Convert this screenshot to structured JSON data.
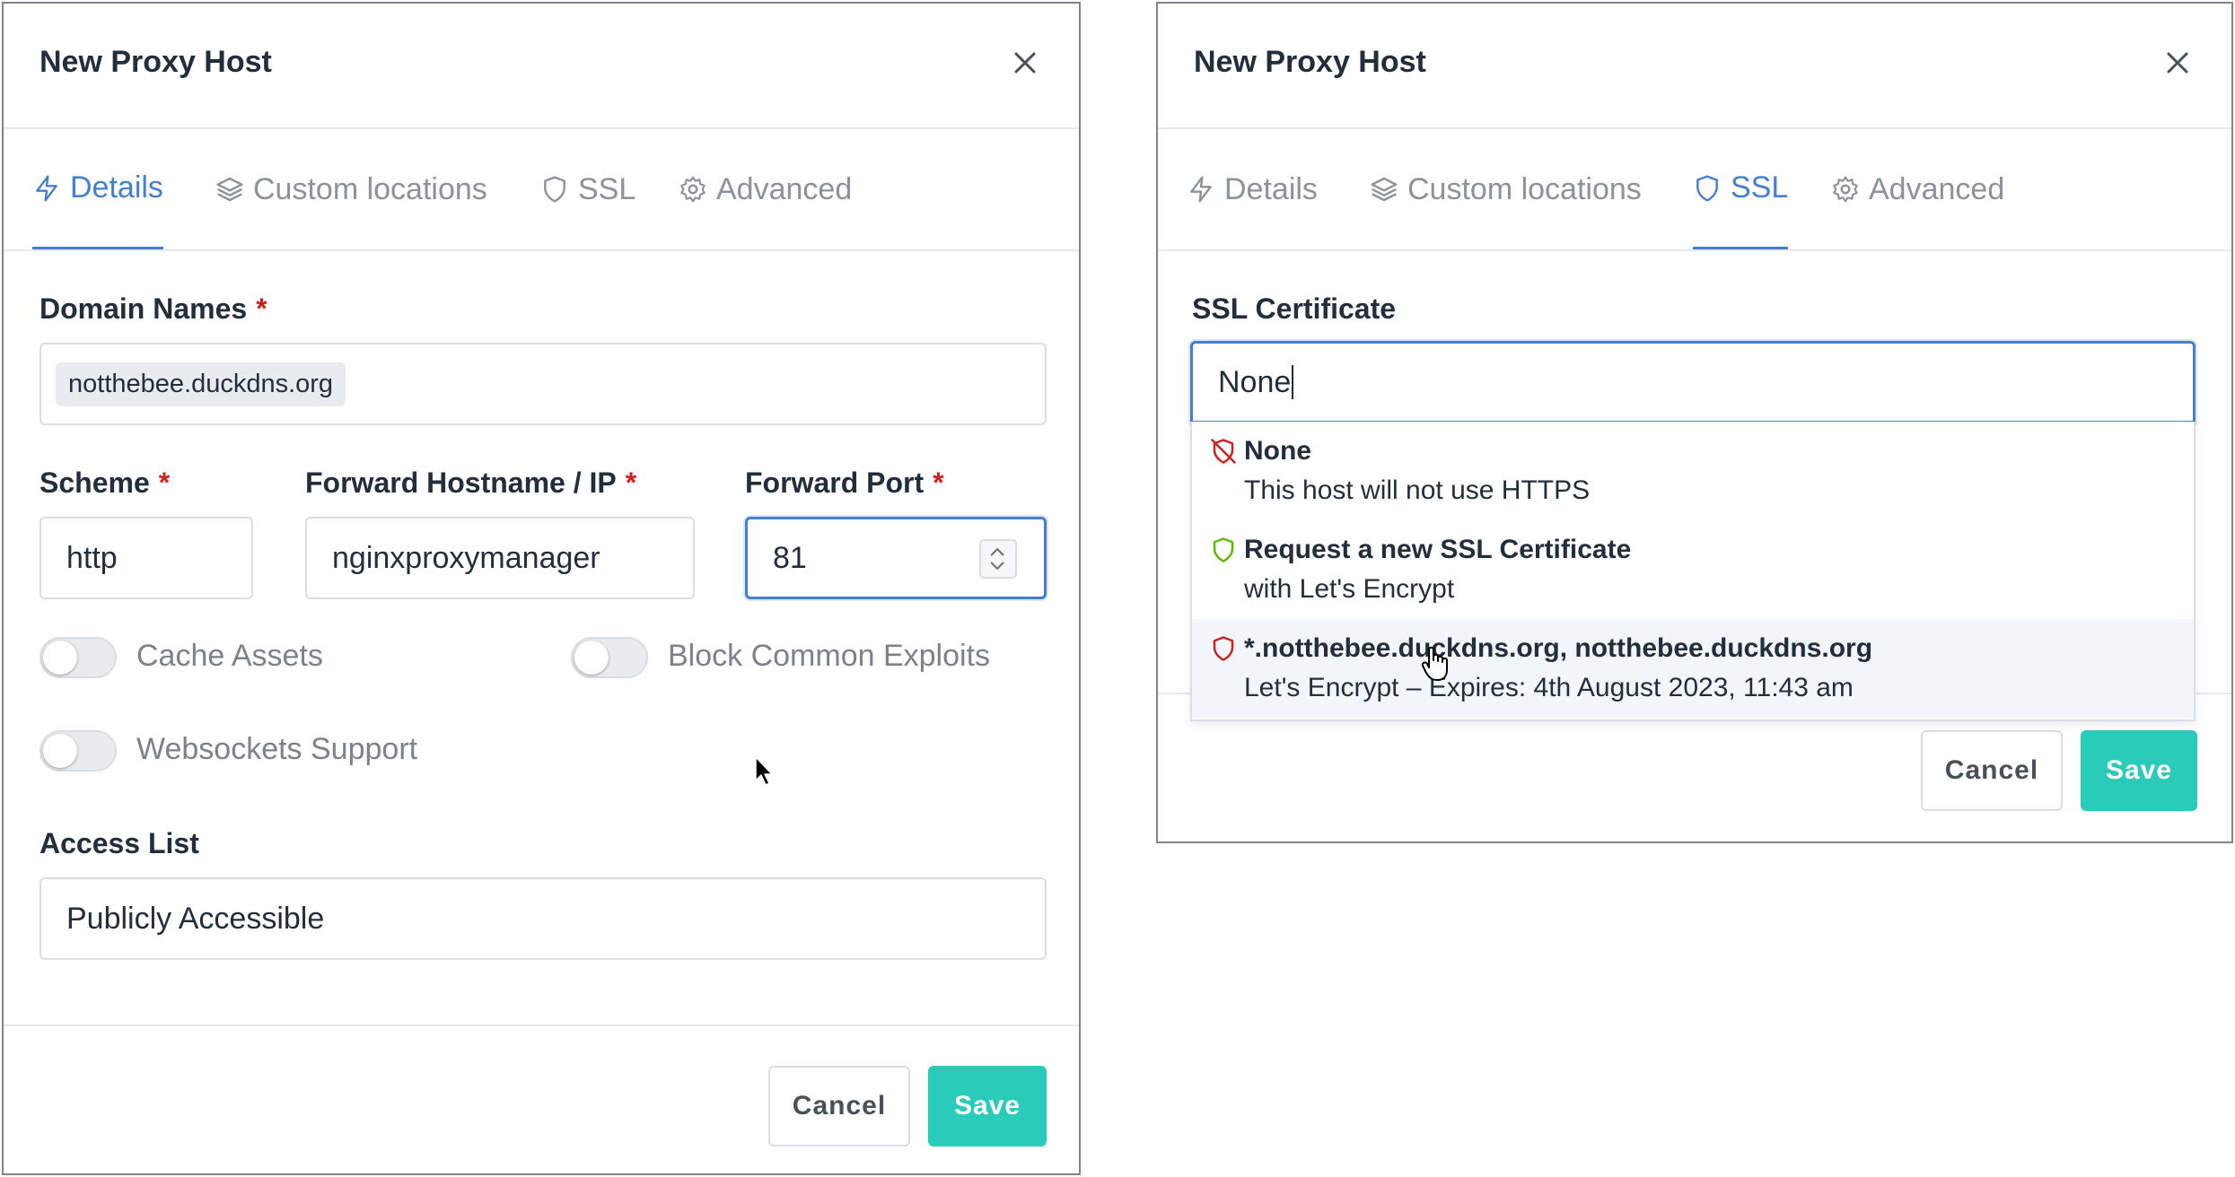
{
  "left_modal": {
    "title": "New Proxy Host",
    "tabs": [
      {
        "label": "Details",
        "icon": "bolt-icon",
        "active": true
      },
      {
        "label": "Custom locations",
        "icon": "layers-icon",
        "active": false
      },
      {
        "label": "SSL",
        "icon": "shield-icon",
        "active": false
      },
      {
        "label": "Advanced",
        "icon": "gear-icon",
        "active": false
      }
    ],
    "domain_names": {
      "label": "Domain Names",
      "required": "*",
      "chips": [
        "notthebee.duckdns.org"
      ]
    },
    "scheme": {
      "label": "Scheme",
      "required": "*",
      "value": "http"
    },
    "forward_hostname": {
      "label": "Forward Hostname / IP",
      "required": "*",
      "value": "nginxproxymanager"
    },
    "forward_port": {
      "label": "Forward Port",
      "required": "*",
      "value": "81"
    },
    "toggles": {
      "cache_assets": {
        "label": "Cache Assets",
        "on": false
      },
      "block_exploits": {
        "label": "Block Common Exploits",
        "on": false
      },
      "websockets": {
        "label": "Websockets Support",
        "on": false
      }
    },
    "access_list": {
      "label": "Access List",
      "value": "Publicly Accessible"
    },
    "buttons": {
      "cancel": "Cancel",
      "save": "Save"
    }
  },
  "right_modal": {
    "title": "New Proxy Host",
    "tabs": [
      {
        "label": "Details",
        "icon": "bolt-icon",
        "active": false
      },
      {
        "label": "Custom locations",
        "icon": "layers-icon",
        "active": false
      },
      {
        "label": "SSL",
        "icon": "shield-icon",
        "active": true
      },
      {
        "label": "Advanced",
        "icon": "gear-icon",
        "active": false
      }
    ],
    "ssl_certificate": {
      "label": "SSL Certificate",
      "value": "None"
    },
    "options": [
      {
        "title": "None",
        "subtitle": "This host will not use HTTPS",
        "icon": "shield-off-icon",
        "icon_color": "#cd201f"
      },
      {
        "title": "Request a new SSL Certificate",
        "subtitle": "with Let's Encrypt",
        "icon": "shield-icon",
        "icon_color": "#5eba00"
      },
      {
        "title": "*.notthebee.duckdns.org, notthebee.duckdns.org",
        "subtitle": "Let's Encrypt – Expires: 4th August 2023, 11:43 am",
        "icon": "shield-icon",
        "icon_color": "#cd201f"
      }
    ],
    "buttons": {
      "cancel": "Cancel",
      "save": "Save"
    }
  },
  "colors": {
    "accent": "#467fcf",
    "save": "#2bcbba",
    "required": "#cd201f"
  }
}
